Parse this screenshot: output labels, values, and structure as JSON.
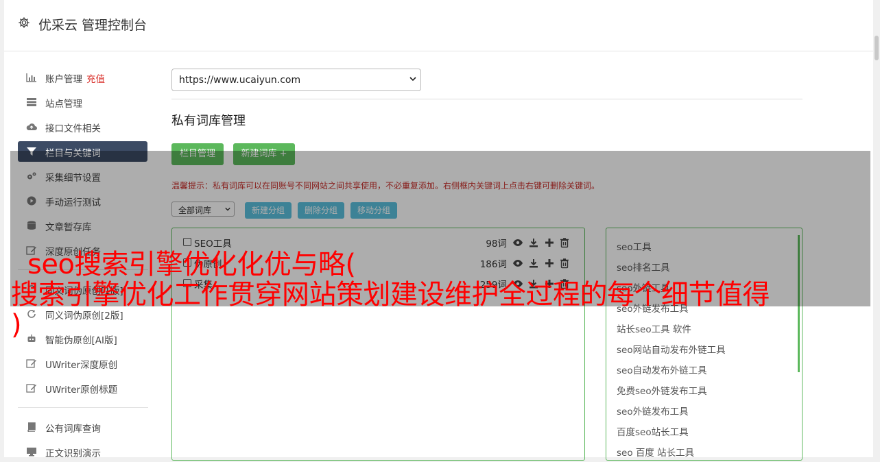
{
  "header": {
    "title": "优采云 管理控制台",
    "icon": "gear-icon"
  },
  "sidebar": {
    "items": [
      {
        "label": "账户管理",
        "badge": "充值",
        "icon": "bar-chart-icon"
      },
      {
        "label": "站点管理",
        "icon": "server-icon"
      },
      {
        "label": "接口文件相关",
        "icon": "cloud-upload-icon"
      },
      {
        "label": "栏目与关键词",
        "icon": "filter-icon",
        "active": true
      },
      {
        "label": "采集细节设置",
        "icon": "cogs-icon"
      },
      {
        "label": "手动运行测试",
        "icon": "play-circle-icon"
      },
      {
        "label": "文章暂存库",
        "icon": "database-icon"
      },
      {
        "label": "深度原创任务",
        "icon": "edit-icon"
      },
      {
        "label": "同义词伪原创[1版]",
        "icon": "refresh-icon"
      },
      {
        "label": "同义词伪原创[2版]",
        "icon": "refresh-icon"
      },
      {
        "label": "智能伪原创[AI版]",
        "icon": "robot-icon"
      },
      {
        "label": "UWriter深度原创",
        "icon": "edit-icon"
      },
      {
        "label": "UWriter原创标题",
        "icon": "edit-icon"
      },
      {
        "label": "公有词库查询",
        "icon": "book-icon"
      },
      {
        "label": "正文识别演示",
        "icon": "monitor-icon"
      }
    ]
  },
  "main": {
    "site_select": "https://www.ucaiyun.com",
    "section_title": "私有词库管理",
    "buttons": {
      "columns": "栏目管理",
      "new_lib": "新建词库 +"
    },
    "tip": "温馨提示：私有词库可以在同账号不同网站之间共享使用，不必重复添加。右侧框内关键词上点击右键可删除关键词。",
    "filter_select": "全部词库",
    "group_buttons": {
      "new": "新建分组",
      "delete": "删除分组",
      "move": "移动分组"
    },
    "groups": [
      {
        "name": "SEO工具",
        "count": "98词"
      },
      {
        "name": "伪原创",
        "count": "186词"
      },
      {
        "name": "采集",
        "count": "259词"
      }
    ],
    "keywords": [
      "seo工具",
      "seo排名工具",
      "seo外链工具",
      "seo外链发布工具",
      "站长seo工具 软件",
      "seo网站自动发布外链工具",
      "seo自动发布外链工具",
      "免费seo外链发布工具",
      "seo外链发布工具",
      "百度seo站长工具",
      "seo 百度 站长工具"
    ]
  },
  "overlay_headline": {
    "line1": "seo搜索引擎优化化优与略(",
    "line2": "搜索引擎优化工作贯穿网站策划建设维护全过程的每个细节值得",
    "line3": ")"
  },
  "colors": {
    "accent_green": "#5cb85c",
    "info_blue": "#5bc0de",
    "active_nav": "#3c4b64",
    "headline_red": "#ff0000",
    "tip_red": "#c9302c"
  }
}
